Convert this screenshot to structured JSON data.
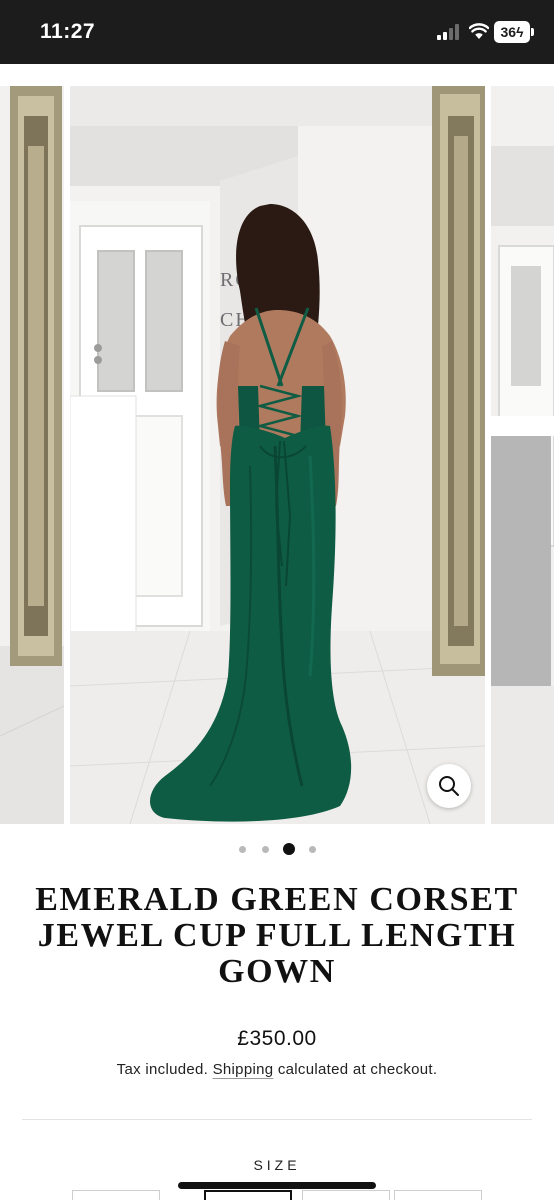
{
  "status_bar": {
    "time": "11:27",
    "battery": "36"
  },
  "gallery": {
    "dots_total": 4,
    "active_dot_index": 2,
    "wall_sign": "ROSE CHE",
    "dress_color": "#0f5c44"
  },
  "product": {
    "title": "EMERALD GREEN CORSET JEWEL CUP FULL LENGTH GOWN",
    "price": "£350.00",
    "tax_text": "Tax included.",
    "shipping_link": "Shipping",
    "tax_suffix": "calculated at checkout."
  },
  "size_section": {
    "label": "SIZE"
  },
  "colors": {
    "status_bar_bg": "#1c1c1c",
    "text": "#111111",
    "dot_inactive": "#b9b9b9",
    "dot_active": "#111111"
  }
}
